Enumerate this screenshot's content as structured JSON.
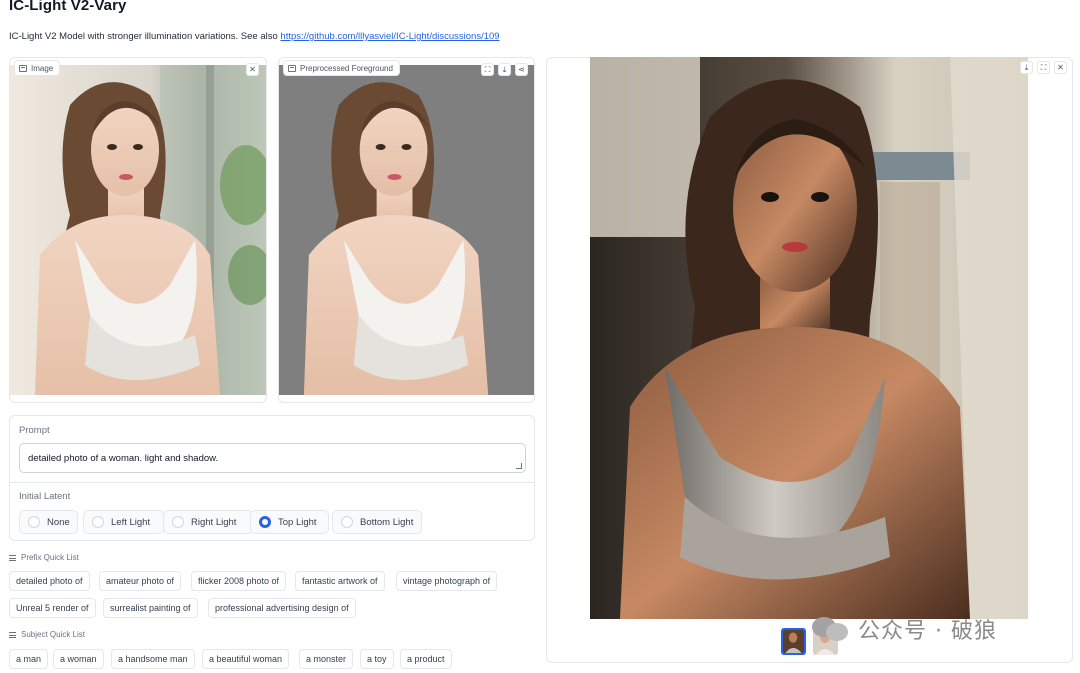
{
  "header": {
    "title": "IC-Light V2-Vary",
    "description_prefix": "IC-Light V2 Model with stronger illumination variations. See also ",
    "description_link": "https://github.com/lllyasviel/IC-Light/discussions/109"
  },
  "input_image": {
    "label": "Image",
    "close_icon": "close-icon"
  },
  "foreground_image": {
    "label": "Preprocessed Foreground",
    "tools": [
      "fullscreen-icon",
      "download-icon",
      "share-icon"
    ]
  },
  "prompt": {
    "label": "Prompt",
    "value": "detailed photo of a woman. light and shadow."
  },
  "initial_latent": {
    "label": "Initial Latent",
    "options": [
      "None",
      "Left Light",
      "Right Light",
      "Top Light",
      "Bottom Light"
    ],
    "selected": "Top Light"
  },
  "prefix_quick_list": {
    "label": "Prefix Quick List",
    "items": [
      "detailed photo of",
      "amateur photo of",
      "flicker 2008 photo of",
      "fantastic artwork of",
      "vintage photograph of",
      "Unreal 5 render of",
      "surrealist painting of",
      "professional advertising design of"
    ]
  },
  "subject_quick_list": {
    "label": "Subject Quick List",
    "items": [
      "a man",
      "a woman",
      "a handsome man",
      "a beautiful woman",
      "a monster",
      "a toy",
      "a product"
    ]
  },
  "output_gallery": {
    "tools": [
      "download-icon",
      "fullscreen-icon",
      "close-icon"
    ],
    "thumbnail_count": 2
  },
  "watermark": {
    "text": "公众号 · 破狼"
  },
  "colors": {
    "accent": "#2563eb",
    "border": "#e5e7eb",
    "link": "#2563eb"
  }
}
